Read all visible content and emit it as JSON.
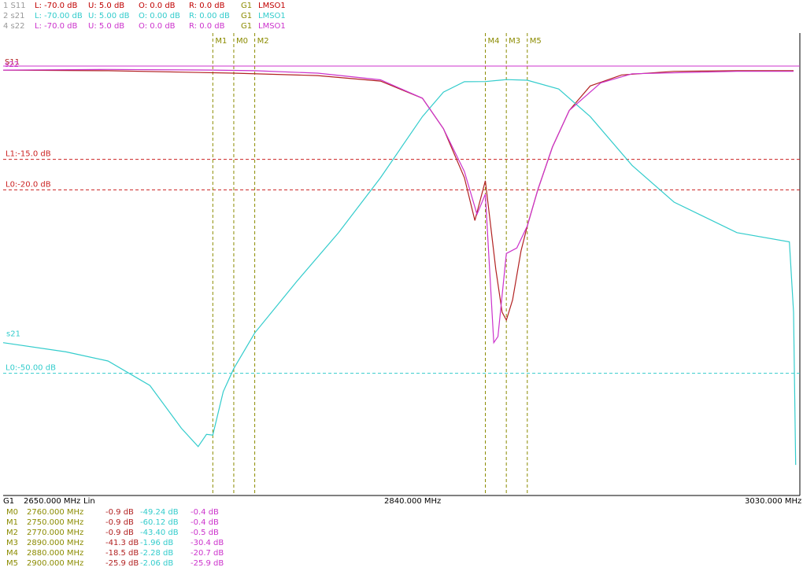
{
  "header": {
    "traces": [
      {
        "id": "1 S11",
        "lower": "L: -70.0 dB",
        "upper": "U:  5.0 dB",
        "offset": "O:  0.0 dB",
        "ref": "R:  0.0 dB",
        "group": "G1",
        "marker_set": "LMSO1",
        "color": "#c00000"
      },
      {
        "id": "2 s21",
        "lower": "L: -70.00 dB",
        "upper": "U: 5.00 dB",
        "offset": "O: 0.00 dB",
        "ref": "R: 0.00 dB",
        "group": "G1",
        "marker_set": "LMSO1",
        "color": "#33cccc"
      },
      {
        "id": "4 s22",
        "lower": "L: -70.0 dB",
        "upper": "U:  5.0 dB",
        "offset": "O:  0.0 dB",
        "ref": "R:  0.0 dB",
        "group": "G1",
        "marker_set": "LMSO1",
        "color": "#cc33cc"
      }
    ]
  },
  "colors": {
    "s11": "#b22222",
    "s21": "#33cccc",
    "s22": "#cc33cc",
    "marker": "#8b8b00",
    "limit_red": "#cc2222",
    "limit_cyan": "#33cccc",
    "axis": "#000000"
  },
  "chart_data": {
    "type": "line",
    "x_unit": "MHz",
    "xlim": [
      2650,
      3030
    ],
    "ylim": [
      -70,
      5
    ],
    "series": [
      {
        "name": "S11",
        "color": "#b22222",
        "points": [
          [
            2650,
            -0.4
          ],
          [
            2700,
            -0.5
          ],
          [
            2760,
            -0.9
          ],
          [
            2800,
            -1.3
          ],
          [
            2830,
            -2.2
          ],
          [
            2850,
            -5
          ],
          [
            2860,
            -10
          ],
          [
            2870,
            -18
          ],
          [
            2875,
            -25
          ],
          [
            2880,
            -18.5
          ],
          [
            2885,
            -33
          ],
          [
            2888,
            -40
          ],
          [
            2890,
            -41.3
          ],
          [
            2893,
            -38
          ],
          [
            2897,
            -30
          ],
          [
            2900,
            -25.9
          ],
          [
            2905,
            -20
          ],
          [
            2912,
            -13
          ],
          [
            2920,
            -7
          ],
          [
            2930,
            -3
          ],
          [
            2945,
            -1.2
          ],
          [
            2970,
            -0.6
          ],
          [
            3000,
            -0.5
          ],
          [
            3027,
            -0.5
          ]
        ]
      },
      {
        "name": "s21",
        "color": "#33cccc",
        "points": [
          [
            2650,
            -45
          ],
          [
            2680,
            -46.5
          ],
          [
            2700,
            -48
          ],
          [
            2720,
            -52
          ],
          [
            2735,
            -59
          ],
          [
            2743,
            -62
          ],
          [
            2747,
            -60
          ],
          [
            2750,
            -60.12
          ],
          [
            2755,
            -53
          ],
          [
            2760,
            -49.24
          ],
          [
            2770,
            -43.4
          ],
          [
            2790,
            -35
          ],
          [
            2810,
            -27
          ],
          [
            2830,
            -18
          ],
          [
            2850,
            -8
          ],
          [
            2860,
            -4
          ],
          [
            2870,
            -2.3
          ],
          [
            2880,
            -2.28
          ],
          [
            2890,
            -1.96
          ],
          [
            2900,
            -2.06
          ],
          [
            2915,
            -3.5
          ],
          [
            2930,
            -8
          ],
          [
            2950,
            -16
          ],
          [
            2970,
            -22
          ],
          [
            3000,
            -27
          ],
          [
            3025,
            -28.5
          ],
          [
            3027,
            -40
          ],
          [
            3028,
            -65
          ]
        ]
      },
      {
        "name": "s22",
        "color": "#cc33cc",
        "points": [
          [
            2650,
            -0.4
          ],
          [
            2700,
            -0.3
          ],
          [
            2750,
            -0.4
          ],
          [
            2770,
            -0.5
          ],
          [
            2800,
            -0.9
          ],
          [
            2830,
            -2
          ],
          [
            2850,
            -5
          ],
          [
            2860,
            -10
          ],
          [
            2870,
            -17
          ],
          [
            2876,
            -24
          ],
          [
            2880,
            -20.7
          ],
          [
            2884,
            -45
          ],
          [
            2886,
            -44
          ],
          [
            2890,
            -30.4
          ],
          [
            2895,
            -29.5
          ],
          [
            2900,
            -25.9
          ],
          [
            2905,
            -20
          ],
          [
            2912,
            -13
          ],
          [
            2920,
            -7
          ],
          [
            2935,
            -2.5
          ],
          [
            2950,
            -1
          ],
          [
            3000,
            -0.6
          ],
          [
            3027,
            -0.6
          ]
        ]
      }
    ],
    "limit_lines": [
      {
        "label": "L1:-15.0 dB",
        "value": -15,
        "color": "#cc2222"
      },
      {
        "label": "L0:-20.0 dB",
        "value": -20,
        "color": "#cc2222"
      },
      {
        "label": "L0:-50.00 dB",
        "value": -50,
        "color": "#33cccc"
      }
    ],
    "markers": [
      {
        "name": "M1",
        "x": 2750
      },
      {
        "name": "M0",
        "x": 2760
      },
      {
        "name": "M2",
        "x": 2770
      },
      {
        "name": "M4",
        "x": 2880
      },
      {
        "name": "M3",
        "x": 2890
      },
      {
        "name": "M5",
        "x": 2900
      }
    ],
    "trace_labels": [
      {
        "text": "s21",
        "series": "s21"
      },
      {
        "text": "S11",
        "series": "S11"
      },
      {
        "text": "s22",
        "series": "s22"
      }
    ],
    "x_axis": {
      "start": "2650.000 MHz",
      "center": "2840.000 MHz",
      "stop": "3030.000 MHz",
      "group": "G1",
      "scale": "Lin"
    }
  },
  "marker_table": [
    {
      "name": "M0",
      "freq": "2760.000 MHz",
      "s11": "-0.9 dB",
      "s21": "-49.24 dB",
      "s22": "-0.4 dB"
    },
    {
      "name": "M1",
      "freq": "2750.000 MHz",
      "s11": "-0.9 dB",
      "s21": "-60.12 dB",
      "s22": "-0.4 dB"
    },
    {
      "name": "M2",
      "freq": "2770.000 MHz",
      "s11": "-0.9 dB",
      "s21": "-43.40 dB",
      "s22": "-0.5 dB"
    },
    {
      "name": "M3",
      "freq": "2890.000 MHz",
      "s11": "-41.3 dB",
      "s21": "-1.96 dB",
      "s22": "-30.4 dB"
    },
    {
      "name": "M4",
      "freq": "2880.000 MHz",
      "s11": "-18.5 dB",
      "s21": "-2.28 dB",
      "s22": "-20.7 dB"
    },
    {
      "name": "M5",
      "freq": "2900.000 MHz",
      "s11": "-25.9 dB",
      "s21": "-2.06 dB",
      "s22": "-25.9 dB"
    }
  ]
}
